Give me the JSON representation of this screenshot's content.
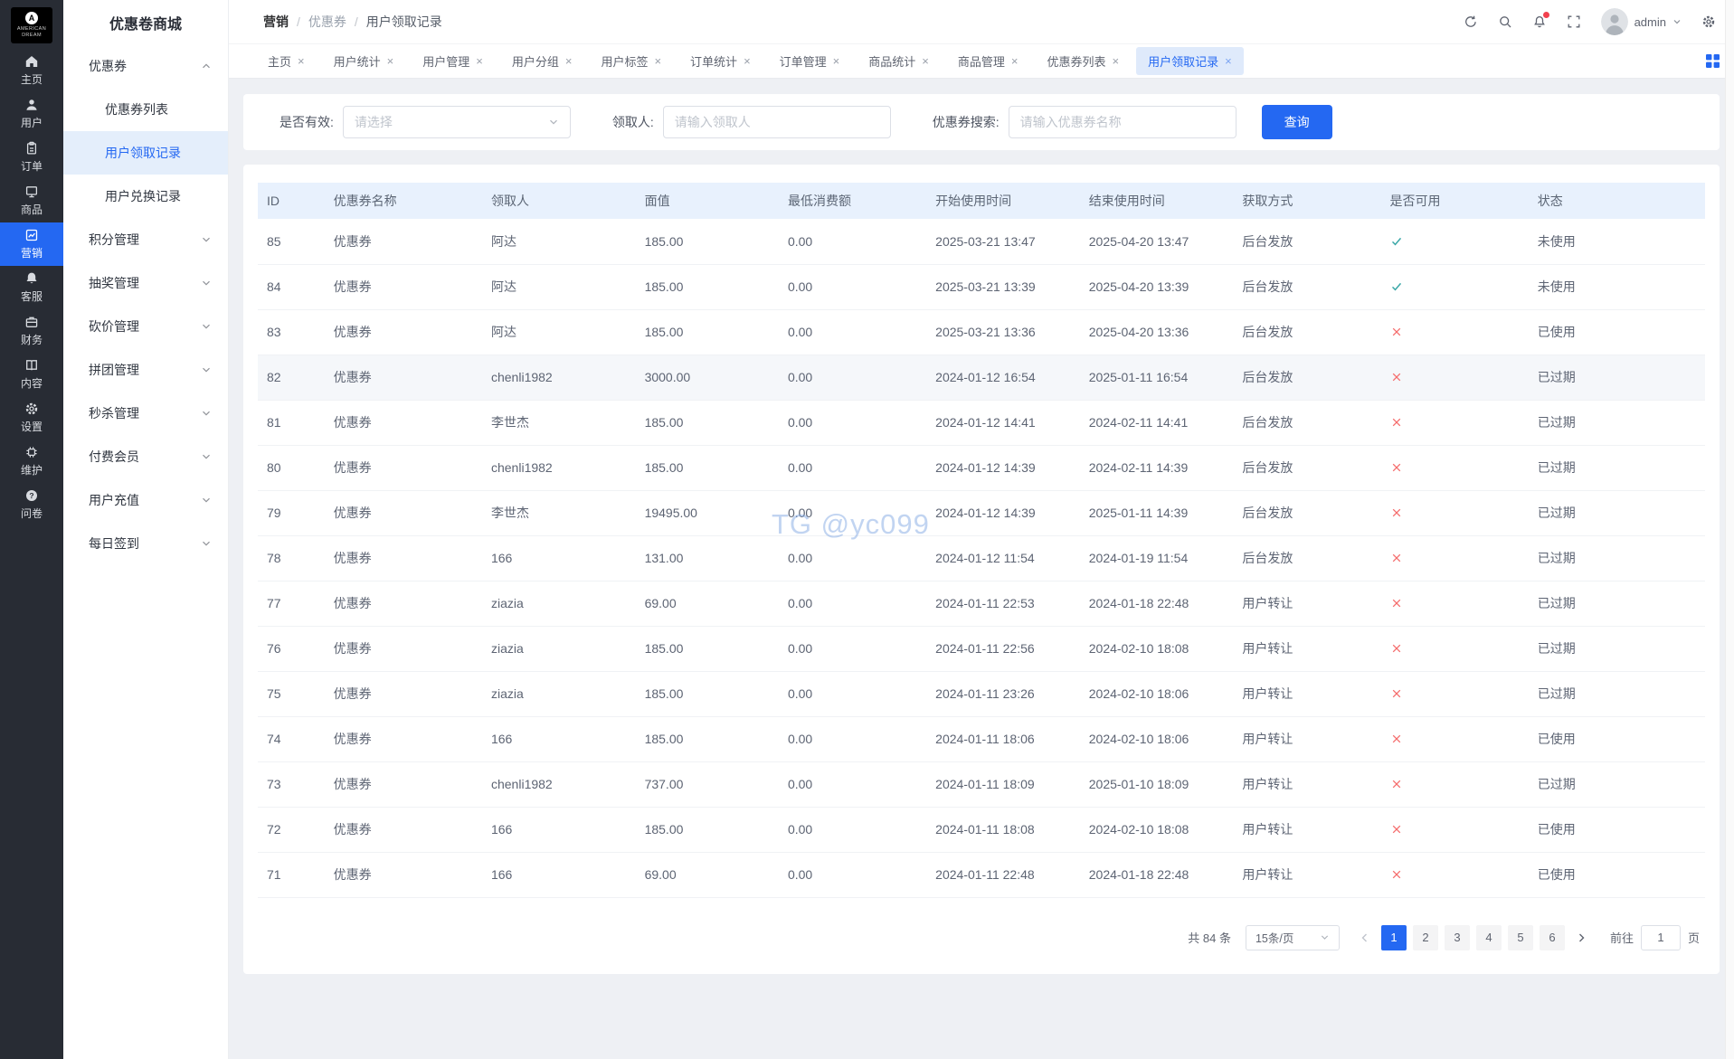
{
  "app": {
    "title": "优惠卷商城",
    "logo_letter": "A",
    "logo_text": "AMERICAN DREAM"
  },
  "colors": {
    "accent": "#2468f2",
    "check": "#3ba8a8",
    "cross": "#f56c6c",
    "table_header_bg": "#e8f1fd"
  },
  "rail": {
    "items": [
      {
        "label": "主页",
        "icon": "home",
        "active": false
      },
      {
        "label": "用户",
        "icon": "user",
        "active": false
      },
      {
        "label": "订单",
        "icon": "order",
        "active": false
      },
      {
        "label": "商品",
        "icon": "goods",
        "active": false
      },
      {
        "label": "营销",
        "icon": "marketing",
        "active": true
      },
      {
        "label": "客服",
        "icon": "service",
        "active": false
      },
      {
        "label": "财务",
        "icon": "finance",
        "active": false
      },
      {
        "label": "内容",
        "icon": "content",
        "active": false
      },
      {
        "label": "设置",
        "icon": "settings",
        "active": false
      },
      {
        "label": "维护",
        "icon": "maintenance",
        "active": false
      },
      {
        "label": "问卷",
        "icon": "survey",
        "active": false
      }
    ]
  },
  "sidebar": {
    "groups": [
      {
        "label": "优惠券",
        "expanded": true,
        "children": [
          {
            "label": "优惠券列表",
            "active": false
          },
          {
            "label": "用户领取记录",
            "active": true
          },
          {
            "label": "用户兑换记录",
            "active": false
          }
        ]
      },
      {
        "label": "积分管理",
        "expanded": false,
        "children": []
      },
      {
        "label": "抽奖管理",
        "expanded": false,
        "children": []
      },
      {
        "label": "砍价管理",
        "expanded": false,
        "children": []
      },
      {
        "label": "拼团管理",
        "expanded": false,
        "children": []
      },
      {
        "label": "秒杀管理",
        "expanded": false,
        "children": []
      },
      {
        "label": "付费会员",
        "expanded": false,
        "children": []
      },
      {
        "label": "用户充值",
        "expanded": false,
        "children": []
      },
      {
        "label": "每日签到",
        "expanded": false,
        "children": []
      }
    ]
  },
  "header": {
    "breadcrumb": [
      "营销",
      "优惠券",
      "用户领取记录"
    ],
    "user": "admin"
  },
  "tabs": [
    {
      "label": "主页",
      "active": false
    },
    {
      "label": "用户统计",
      "active": false
    },
    {
      "label": "用户管理",
      "active": false
    },
    {
      "label": "用户分组",
      "active": false
    },
    {
      "label": "用户标签",
      "active": false
    },
    {
      "label": "订单统计",
      "active": false
    },
    {
      "label": "订单管理",
      "active": false
    },
    {
      "label": "商品统计",
      "active": false
    },
    {
      "label": "商品管理",
      "active": false
    },
    {
      "label": "优惠券列表",
      "active": false
    },
    {
      "label": "用户领取记录",
      "active": true
    }
  ],
  "filters": {
    "valid_label": "是否有效:",
    "valid_placeholder": "请选择",
    "receiver_label": "领取人:",
    "receiver_placeholder": "请输入领取人",
    "coupon_label": "优惠券搜索:",
    "coupon_placeholder": "请输入优惠券名称",
    "search_button": "查询"
  },
  "table": {
    "columns": [
      "ID",
      "优惠券名称",
      "领取人",
      "面值",
      "最低消费额",
      "开始使用时间",
      "结束使用时间",
      "获取方式",
      "是否可用",
      "状态"
    ],
    "rows": [
      {
        "id": "85",
        "name": "优惠券",
        "receiver": "阿达",
        "value": "185.00",
        "min": "0.00",
        "start": "2025-03-21 13:47",
        "end": "2025-04-20 13:47",
        "method": "后台发放",
        "available": true,
        "status": "未使用",
        "highlight": false
      },
      {
        "id": "84",
        "name": "优惠券",
        "receiver": "阿达",
        "value": "185.00",
        "min": "0.00",
        "start": "2025-03-21 13:39",
        "end": "2025-04-20 13:39",
        "method": "后台发放",
        "available": true,
        "status": "未使用",
        "highlight": false
      },
      {
        "id": "83",
        "name": "优惠券",
        "receiver": "阿达",
        "value": "185.00",
        "min": "0.00",
        "start": "2025-03-21 13:36",
        "end": "2025-04-20 13:36",
        "method": "后台发放",
        "available": false,
        "status": "已使用",
        "highlight": false
      },
      {
        "id": "82",
        "name": "优惠券",
        "receiver": "chenli1982",
        "value": "3000.00",
        "min": "0.00",
        "start": "2024-01-12 16:54",
        "end": "2025-01-11 16:54",
        "method": "后台发放",
        "available": false,
        "status": "已过期",
        "highlight": true
      },
      {
        "id": "81",
        "name": "优惠券",
        "receiver": "李世杰",
        "value": "185.00",
        "min": "0.00",
        "start": "2024-01-12 14:41",
        "end": "2024-02-11 14:41",
        "method": "后台发放",
        "available": false,
        "status": "已过期",
        "highlight": false
      },
      {
        "id": "80",
        "name": "优惠券",
        "receiver": "chenli1982",
        "value": "185.00",
        "min": "0.00",
        "start": "2024-01-12 14:39",
        "end": "2024-02-11 14:39",
        "method": "后台发放",
        "available": false,
        "status": "已过期",
        "highlight": false
      },
      {
        "id": "79",
        "name": "优惠券",
        "receiver": "李世杰",
        "value": "19495.00",
        "min": "0.00",
        "start": "2024-01-12 14:39",
        "end": "2025-01-11 14:39",
        "method": "后台发放",
        "available": false,
        "status": "已过期",
        "highlight": false
      },
      {
        "id": "78",
        "name": "优惠券",
        "receiver": "166",
        "value": "131.00",
        "min": "0.00",
        "start": "2024-01-12 11:54",
        "end": "2024-01-19 11:54",
        "method": "后台发放",
        "available": false,
        "status": "已过期",
        "highlight": false
      },
      {
        "id": "77",
        "name": "优惠券",
        "receiver": "ziazia",
        "value": "69.00",
        "min": "0.00",
        "start": "2024-01-11 22:53",
        "end": "2024-01-18 22:48",
        "method": "用户转让",
        "available": false,
        "status": "已过期",
        "highlight": false
      },
      {
        "id": "76",
        "name": "优惠券",
        "receiver": "ziazia",
        "value": "185.00",
        "min": "0.00",
        "start": "2024-01-11 22:56",
        "end": "2024-02-10 18:08",
        "method": "用户转让",
        "available": false,
        "status": "已过期",
        "highlight": false
      },
      {
        "id": "75",
        "name": "优惠券",
        "receiver": "ziazia",
        "value": "185.00",
        "min": "0.00",
        "start": "2024-01-11 23:26",
        "end": "2024-02-10 18:06",
        "method": "用户转让",
        "available": false,
        "status": "已过期",
        "highlight": false
      },
      {
        "id": "74",
        "name": "优惠券",
        "receiver": "166",
        "value": "185.00",
        "min": "0.00",
        "start": "2024-01-11 18:06",
        "end": "2024-02-10 18:06",
        "method": "用户转让",
        "available": false,
        "status": "已使用",
        "highlight": false
      },
      {
        "id": "73",
        "name": "优惠券",
        "receiver": "chenli1982",
        "value": "737.00",
        "min": "0.00",
        "start": "2024-01-11 18:09",
        "end": "2025-01-10 18:09",
        "method": "用户转让",
        "available": false,
        "status": "已过期",
        "highlight": false
      },
      {
        "id": "72",
        "name": "优惠券",
        "receiver": "166",
        "value": "185.00",
        "min": "0.00",
        "start": "2024-01-11 18:08",
        "end": "2024-02-10 18:08",
        "method": "用户转让",
        "available": false,
        "status": "已使用",
        "highlight": false
      },
      {
        "id": "71",
        "name": "优惠券",
        "receiver": "166",
        "value": "69.00",
        "min": "0.00",
        "start": "2024-01-11 22:48",
        "end": "2024-01-18 22:48",
        "method": "用户转让",
        "available": false,
        "status": "已使用",
        "highlight": false
      }
    ]
  },
  "pagination": {
    "total": "共 84 条",
    "page_size": "15条/页",
    "pages": [
      "1",
      "2",
      "3",
      "4",
      "5",
      "6"
    ],
    "active_page": "1",
    "goto_label": "前往",
    "goto_value": "1",
    "goto_suffix": "页"
  },
  "watermark": "TG @yc099"
}
